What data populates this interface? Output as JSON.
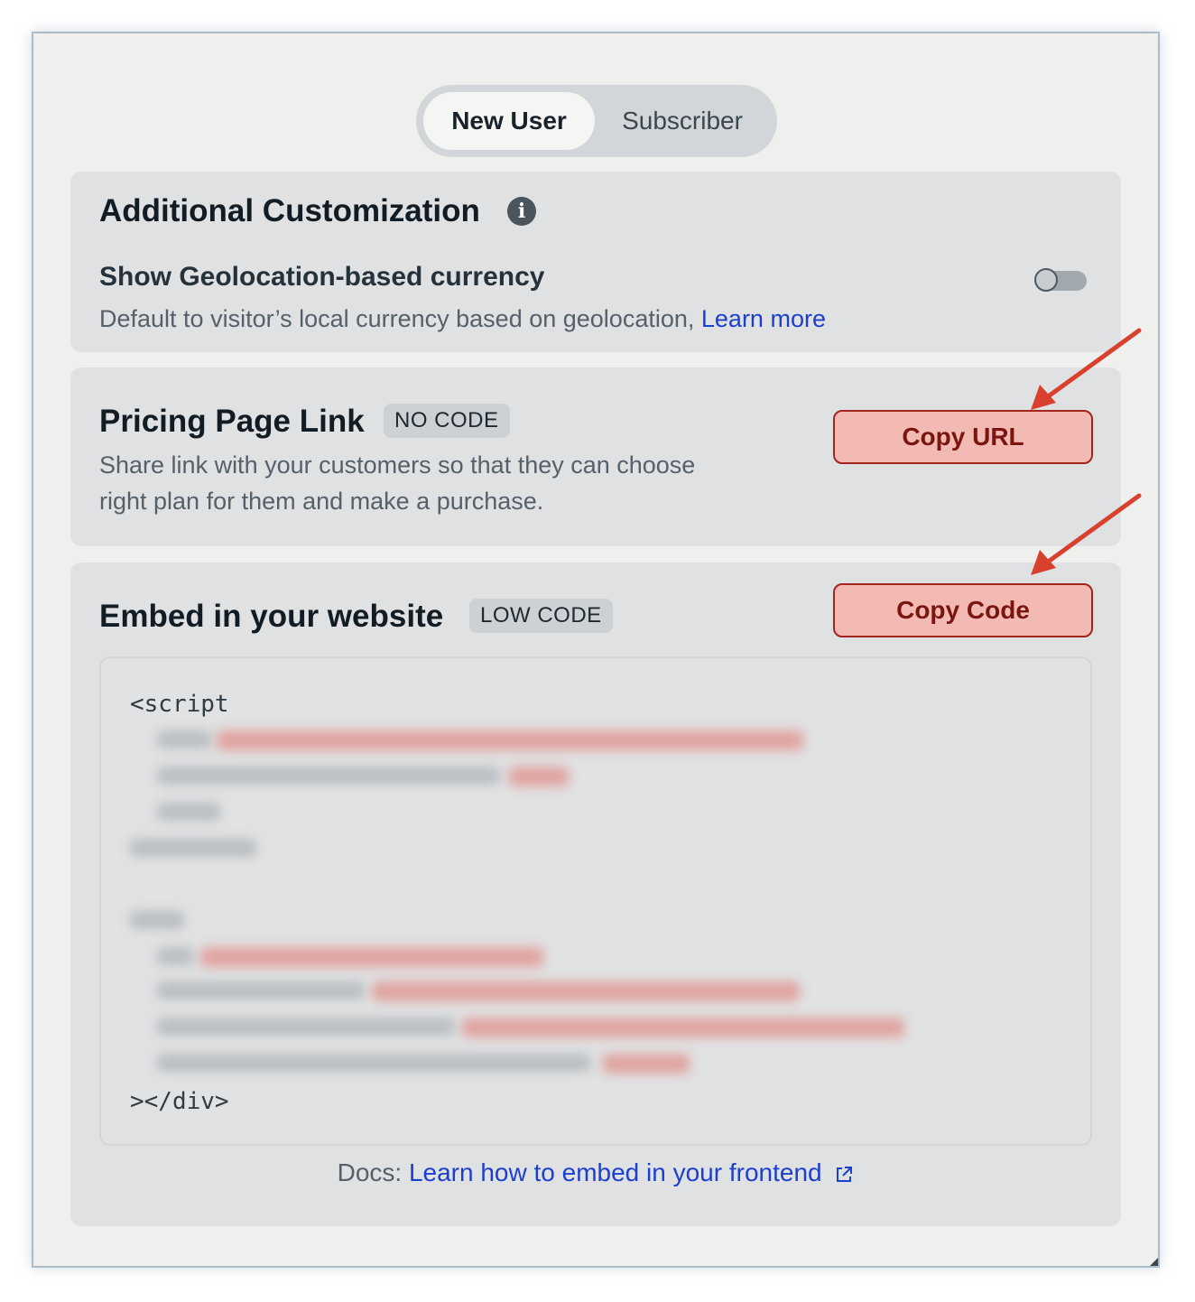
{
  "tabs": [
    {
      "label": "New User",
      "active": true
    },
    {
      "label": "Subscriber",
      "active": false
    }
  ],
  "customization": {
    "title": "Additional Customization",
    "info_icon": "info-icon",
    "setting_title": "Show Geolocation-based currency",
    "setting_desc": "Default to visitor’s local currency based on geolocation,",
    "learn_more": "Learn more",
    "toggle_on": false
  },
  "pricing_link": {
    "title": "Pricing Page Link",
    "badge": "NO CODE",
    "desc_line1": "Share link with your customers so that they can choose",
    "desc_line2": "right plan for them and make a purchase.",
    "button": "Copy URL"
  },
  "embed": {
    "title": "Embed in your website",
    "badge": "LOW CODE",
    "button": "Copy Code",
    "code_start": "<script",
    "code_end": "></div>",
    "docs_prefix": "Docs: ",
    "docs_link": "Learn how to embed in your frontend",
    "docs_icon": "external-link-icon"
  },
  "colors": {
    "accent_link": "#1b3fcf",
    "button_fill": "#f3bab4",
    "button_border": "#a3231d",
    "annotation_arrow": "#d9412f"
  }
}
